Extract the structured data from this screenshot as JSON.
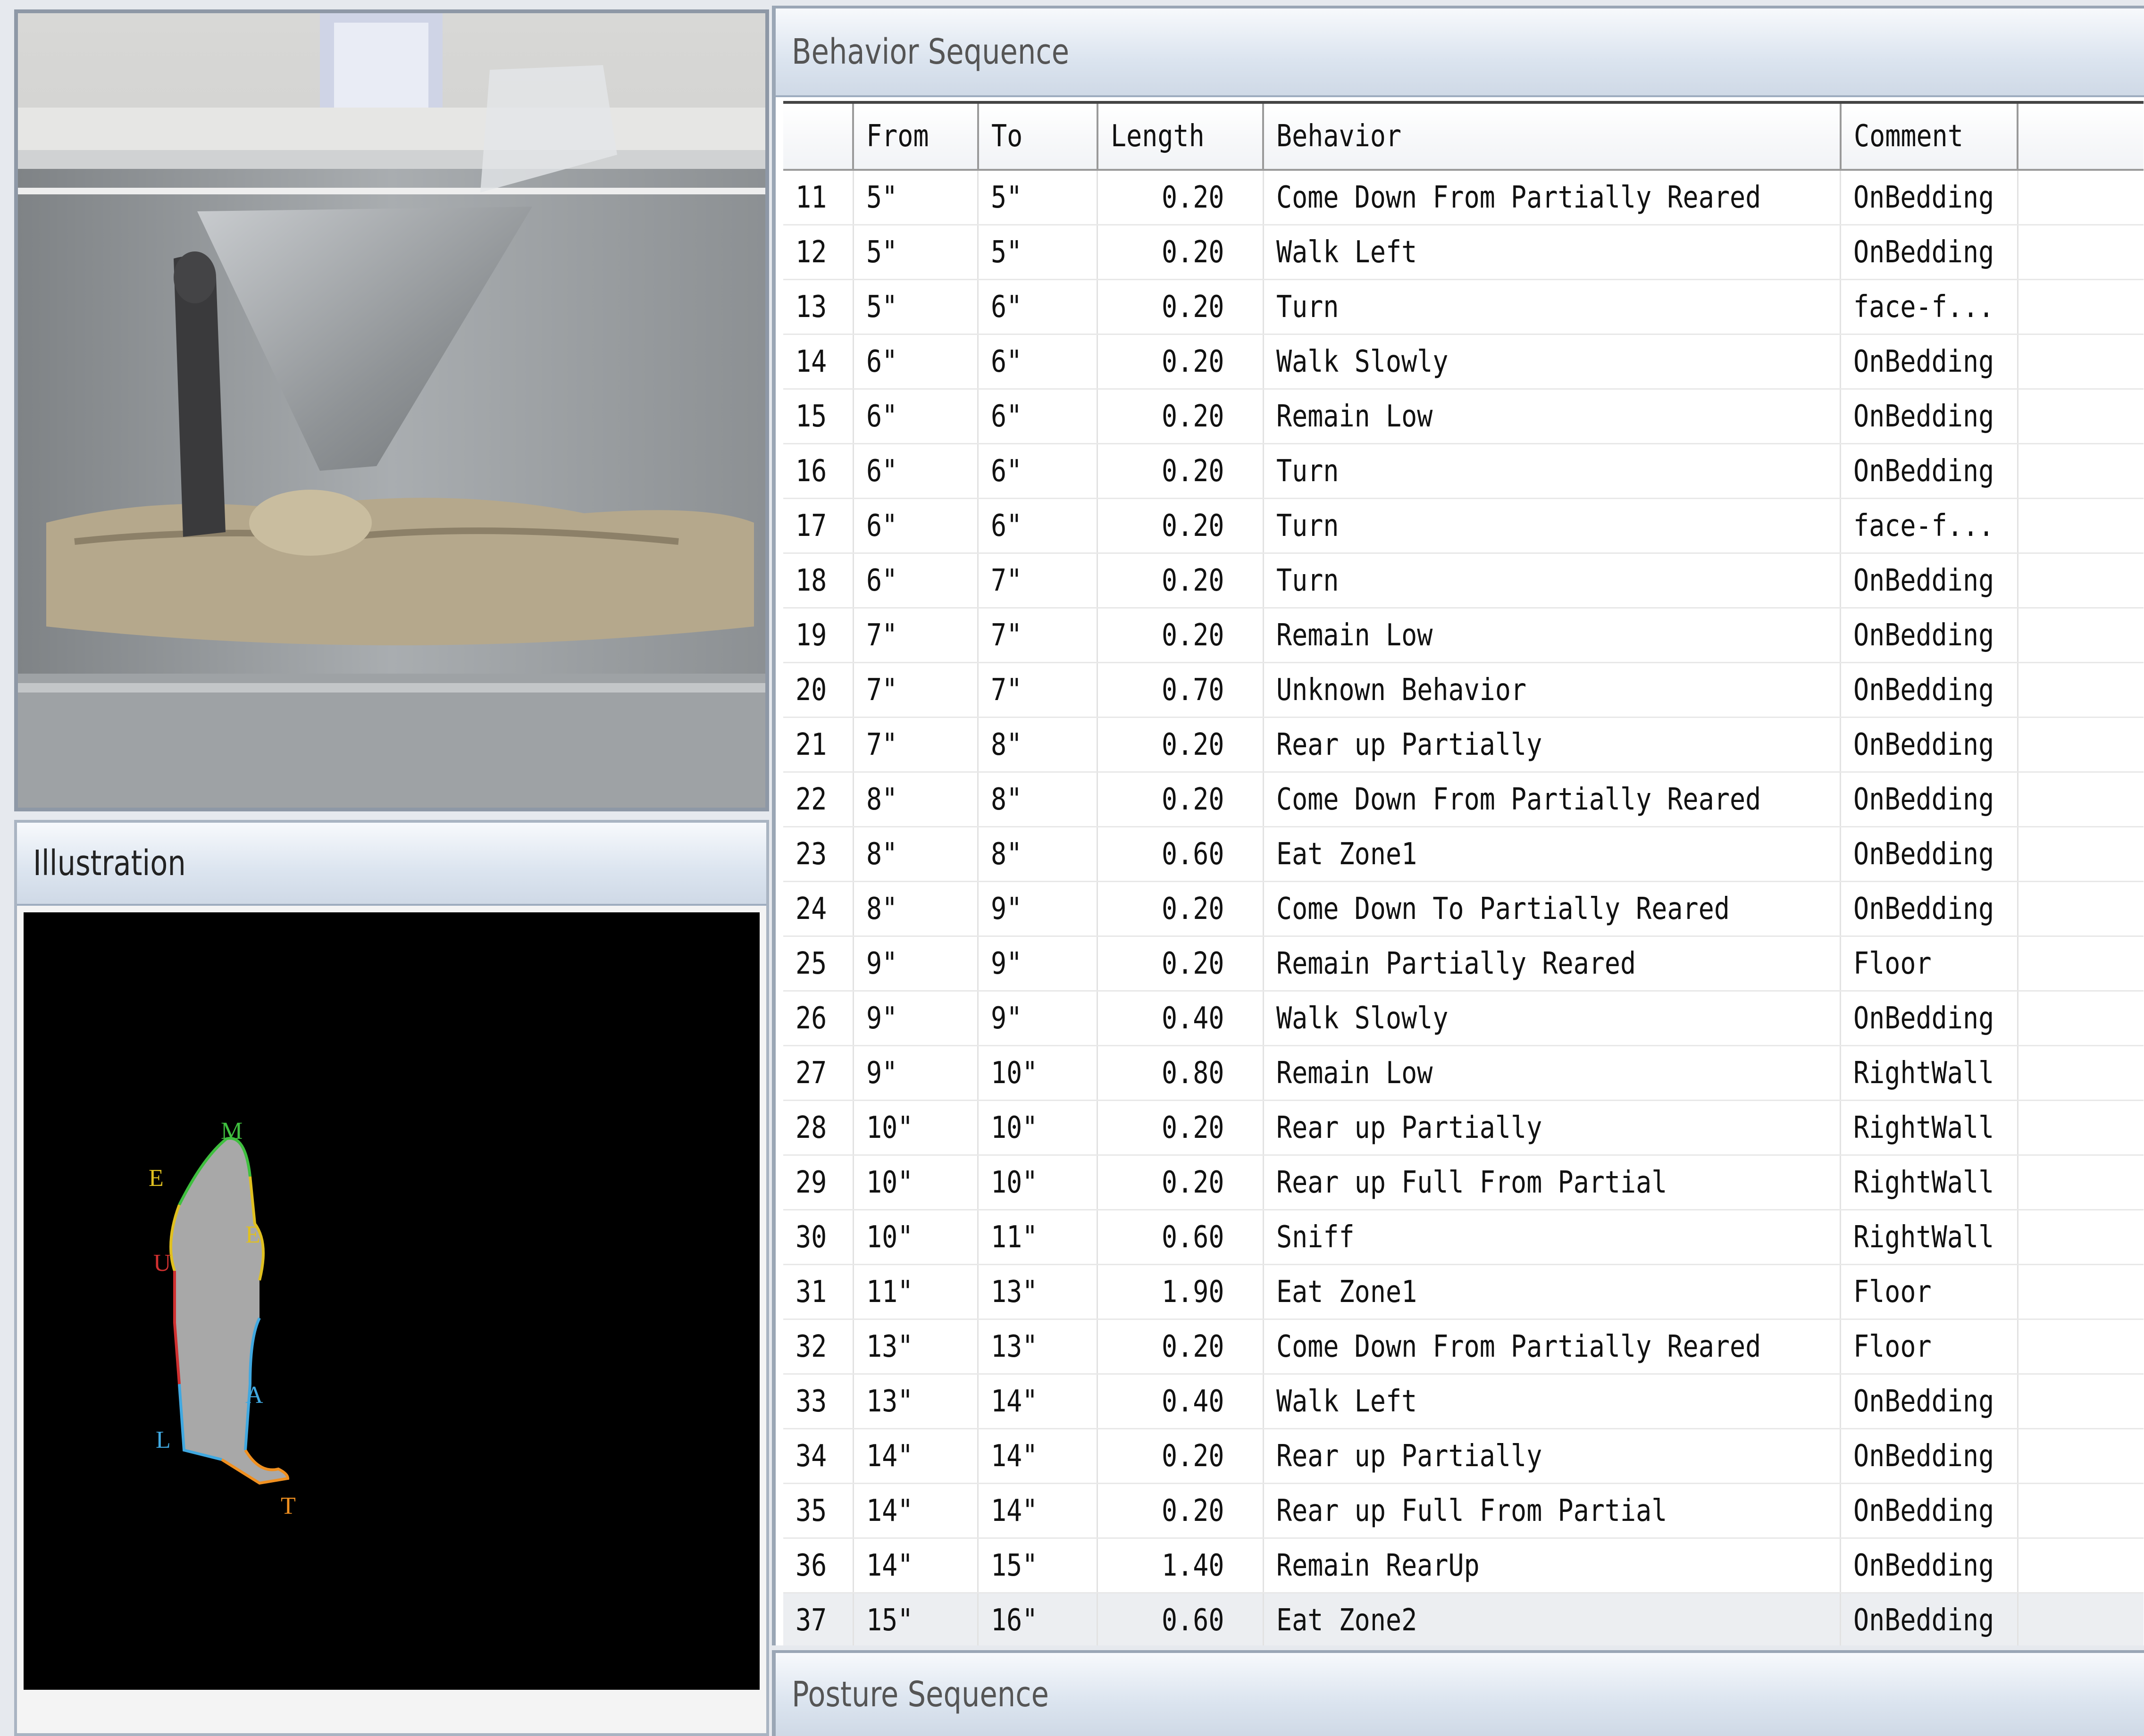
{
  "illustration": {
    "title": "Illustration",
    "labels": [
      "M",
      "E",
      "E",
      "U",
      "A",
      "L",
      "T"
    ]
  },
  "behavior_panel": {
    "title": "Behavior Sequence",
    "columns": [
      "",
      "From",
      "To",
      "Length",
      "Behavior",
      "Comment"
    ],
    "rows": [
      [
        "11",
        "5\"",
        "5\"",
        "0.20",
        "Come Down From Partially Reared",
        "OnBedding"
      ],
      [
        "12",
        "5\"",
        "5\"",
        "0.20",
        "Walk Left",
        "OnBedding"
      ],
      [
        "13",
        "5\"",
        "6\"",
        "0.20",
        "Turn",
        "face-f..."
      ],
      [
        "14",
        "6\"",
        "6\"",
        "0.20",
        "Walk Slowly",
        "OnBedding"
      ],
      [
        "15",
        "6\"",
        "6\"",
        "0.20",
        "Remain Low",
        "OnBedding"
      ],
      [
        "16",
        "6\"",
        "6\"",
        "0.20",
        "Turn",
        "OnBedding"
      ],
      [
        "17",
        "6\"",
        "6\"",
        "0.20",
        "Turn",
        "face-f..."
      ],
      [
        "18",
        "6\"",
        "7\"",
        "0.20",
        "Turn",
        "OnBedding"
      ],
      [
        "19",
        "7\"",
        "7\"",
        "0.20",
        "Remain Low",
        "OnBedding"
      ],
      [
        "20",
        "7\"",
        "7\"",
        "0.70",
        "Unknown Behavior",
        "OnBedding"
      ],
      [
        "21",
        "7\"",
        "8\"",
        "0.20",
        "Rear up Partially",
        "OnBedding"
      ],
      [
        "22",
        "8\"",
        "8\"",
        "0.20",
        "Come Down From Partially Reared",
        "OnBedding"
      ],
      [
        "23",
        "8\"",
        "8\"",
        "0.60",
        "Eat Zone1",
        "OnBedding"
      ],
      [
        "24",
        "8\"",
        "9\"",
        "0.20",
        "Come Down To Partially Reared",
        "OnBedding"
      ],
      [
        "25",
        "9\"",
        "9\"",
        "0.20",
        "Remain Partially Reared",
        "Floor"
      ],
      [
        "26",
        "9\"",
        "9\"",
        "0.40",
        "Walk Slowly",
        "OnBedding"
      ],
      [
        "27",
        "9\"",
        "10\"",
        "0.80",
        "Remain Low",
        "RightWall"
      ],
      [
        "28",
        "10\"",
        "10\"",
        "0.20",
        "Rear up Partially",
        "RightWall"
      ],
      [
        "29",
        "10\"",
        "10\"",
        "0.20",
        "Rear up Full From Partial",
        "RightWall"
      ],
      [
        "30",
        "10\"",
        "11\"",
        "0.60",
        "Sniff",
        "RightWall"
      ],
      [
        "31",
        "11\"",
        "13\"",
        "1.90",
        "Eat Zone1",
        "Floor"
      ],
      [
        "32",
        "13\"",
        "13\"",
        "0.20",
        "Come Down From Partially Reared",
        "Floor"
      ],
      [
        "33",
        "13\"",
        "14\"",
        "0.40",
        "Walk Left",
        "OnBedding"
      ],
      [
        "34",
        "14\"",
        "14\"",
        "0.20",
        "Rear up Partially",
        "OnBedding"
      ],
      [
        "35",
        "14\"",
        "14\"",
        "0.20",
        "Rear up Full From Partial",
        "OnBedding"
      ],
      [
        "36",
        "14\"",
        "15\"",
        "1.40",
        "Remain RearUp",
        "OnBedding"
      ],
      [
        "37",
        "15\"",
        "16\"",
        "0.60",
        "Eat Zone2",
        "OnBedding"
      ]
    ],
    "selected_row_index": 26
  },
  "posture_panel": {
    "title": "Posture Sequence"
  },
  "colors": {
    "header_gradient_top": "#f7f9fc",
    "header_gradient_bottom": "#cfd9e6",
    "grid_line": "#e2e2e2",
    "illustration_bg": "#000000",
    "label_M": "#3fbf3f",
    "label_E": "#e0c020",
    "label_U": "#d03030",
    "label_A": "#40a8e0",
    "label_L": "#40a8e0",
    "label_T": "#f09020"
  }
}
